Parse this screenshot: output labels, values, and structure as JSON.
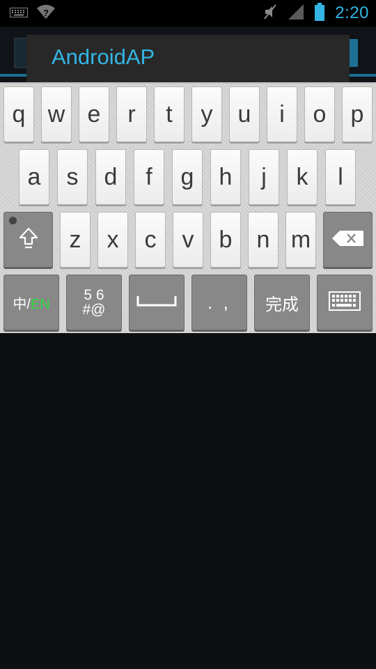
{
  "status_bar": {
    "time": "2:20",
    "left_icons": [
      "keyboard-icon",
      "wifi-question-icon"
    ],
    "right_icons": [
      "mute-icon",
      "signal-icon",
      "battery-icon"
    ],
    "accent_color": "#33b5e5"
  },
  "dialog": {
    "title": "AndroidAP"
  },
  "keyboard": {
    "row1": [
      "q",
      "w",
      "e",
      "r",
      "t",
      "y",
      "u",
      "i",
      "o",
      "p"
    ],
    "row2": [
      "a",
      "s",
      "d",
      "f",
      "g",
      "h",
      "j",
      "k",
      "l"
    ],
    "row3": [
      "z",
      "x",
      "c",
      "v",
      "b",
      "n",
      "m"
    ],
    "lang_switch": {
      "zh": "中",
      "sep": "/",
      "en": "EN"
    },
    "symbols_label": {
      "top": "5 6",
      "bottom": "#@"
    },
    "punctuation_label": ". ,",
    "done_label": "完成",
    "icons": [
      "shift-icon",
      "backspace-icon",
      "space-icon",
      "keyboard-hide-icon"
    ],
    "en_color": "#2edc3e"
  }
}
